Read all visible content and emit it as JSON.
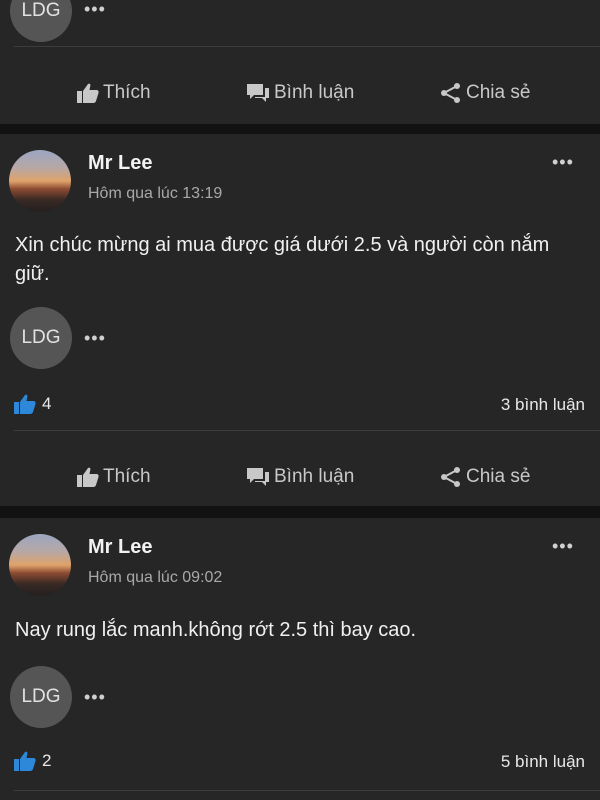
{
  "actions": {
    "like_label": "Thích",
    "comment_label": "Bình luận",
    "share_label": "Chia sẻ"
  },
  "top_partial": {
    "tag": "LDG"
  },
  "posts": [
    {
      "author": "Mr Lee",
      "time": "Hôm qua lúc 13:19",
      "text": "Xin chúc mừng ai mua được giá dưới 2.5 và người còn nắm giữ.",
      "tag": "LDG",
      "likes": "4",
      "comments": "3 bình luận"
    },
    {
      "author": "Mr Lee",
      "time": "Hôm qua lúc 09:02",
      "text": "Nay rung lắc manh.không rớt 2.5 thì bay cao.",
      "tag": "LDG",
      "likes": "2",
      "comments": "5 bình luận"
    }
  ],
  "colors": {
    "background": "#1c1c1c",
    "card": "#262626",
    "like_blue": "#2d88d9"
  },
  "icons": [
    "thumbs-up-icon",
    "comment-icon",
    "share-icon",
    "more-icon"
  ]
}
